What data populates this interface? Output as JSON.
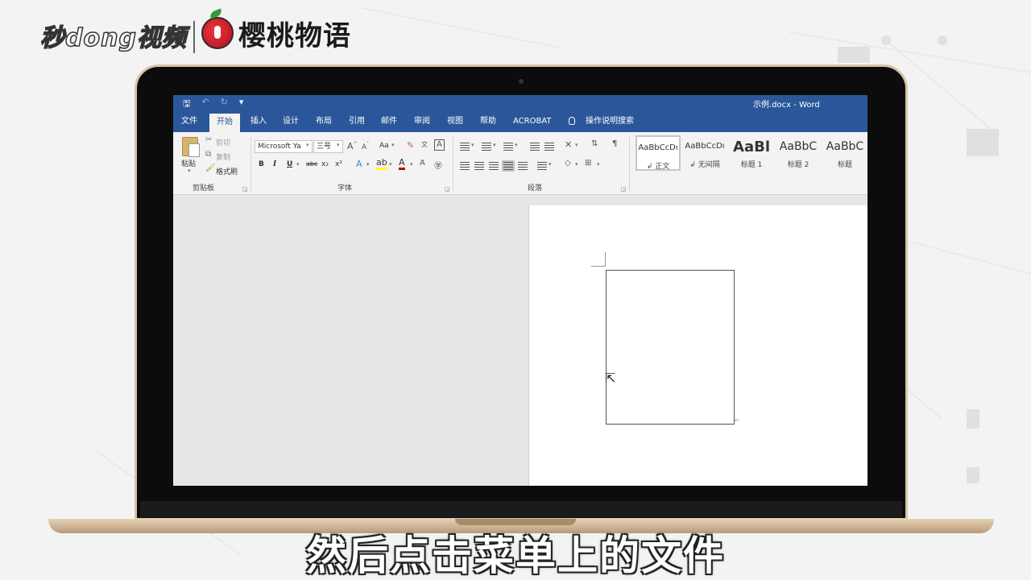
{
  "brand": {
    "left_logo": "秒dong视频",
    "right_logo": "樱桃物语"
  },
  "window": {
    "title": "示例.docx  -  Word"
  },
  "menu": {
    "file": "文件",
    "home": "开始",
    "insert": "插入",
    "design": "设计",
    "layout": "布局",
    "references": "引用",
    "mailings": "邮件",
    "review": "审阅",
    "view": "视图",
    "help": "帮助",
    "acrobat": "ACROBAT",
    "tell_me": "操作说明搜索"
  },
  "clipboard": {
    "paste": "粘贴",
    "cut": "剪切",
    "copy": "复制",
    "format_painter": "格式刷",
    "group_label": "剪贴板"
  },
  "font": {
    "font_name": "Microsoft Ya",
    "font_size": "三号",
    "group_label": "字体",
    "bold": "B",
    "italic": "I",
    "underline": "U",
    "strike": "abc",
    "subscript": "x₂",
    "superscript": "x²",
    "change_case": "Aa"
  },
  "paragraph": {
    "group_label": "段落"
  },
  "styles": {
    "items": [
      {
        "sample": "AaBbCcDı",
        "name": "↲ 正文"
      },
      {
        "sample": "AaBbCcDı",
        "name": "↲ 无间隔"
      },
      {
        "sample": "AaBl",
        "name": "标题 1"
      },
      {
        "sample": "AaBbC",
        "name": "标题 2"
      },
      {
        "sample": "AaBbC",
        "name": "标题"
      }
    ]
  },
  "subtitle": "然后点击菜单上的文件",
  "colors": {
    "ribbon_blue": "#2b579a",
    "font_color_red": "#c00000"
  }
}
